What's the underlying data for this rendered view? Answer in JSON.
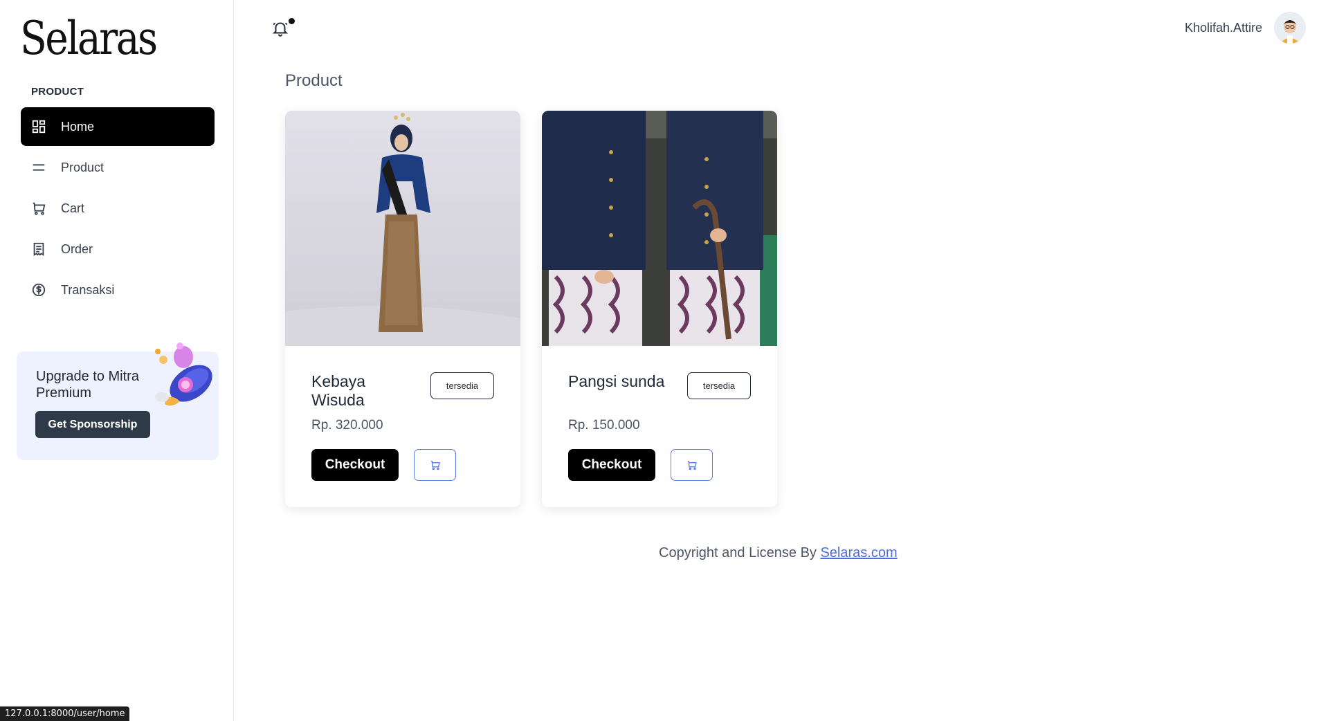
{
  "app": {
    "logo": "Selaras"
  },
  "sidebar": {
    "section_label": "PRODUCT",
    "items": [
      {
        "label": "Home",
        "icon": "grid-icon",
        "active": true
      },
      {
        "label": "Product",
        "icon": "menu-lines-icon",
        "active": false
      },
      {
        "label": "Cart",
        "icon": "cart-icon",
        "active": false
      },
      {
        "label": "Order",
        "icon": "receipt-icon",
        "active": false
      },
      {
        "label": "Transaksi",
        "icon": "dollar-circle-icon",
        "active": false
      }
    ],
    "promo": {
      "title": "Upgrade to Mitra Premium",
      "button": "Get Sponsorship"
    }
  },
  "header": {
    "username": "Kholifah.Attire",
    "notification_dot": true
  },
  "main": {
    "title": "Product",
    "products": [
      {
        "name": "Kebaya Wisuda",
        "status": "tersedia",
        "price": "Rp. 320.000",
        "checkout_label": "Checkout"
      },
      {
        "name": "Pangsi sunda",
        "status": "tersedia",
        "price": "Rp. 150.000",
        "checkout_label": "Checkout"
      }
    ]
  },
  "footer": {
    "text": "Copyright and License By ",
    "link": "Selaras.com"
  },
  "status_url": "127.0.0.1:8000/user/home",
  "colors": {
    "active_nav": "#000000",
    "promo_bg": "#eef2ff",
    "link": "#4b6fd8",
    "cart_border": "#5b7de0"
  }
}
